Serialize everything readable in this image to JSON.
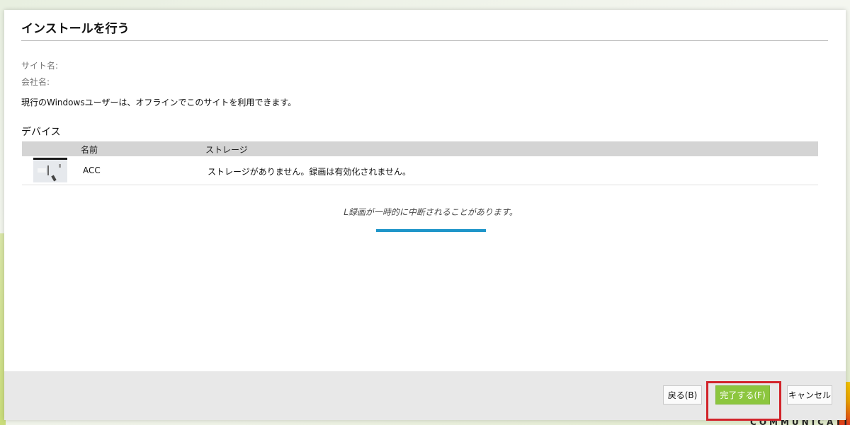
{
  "dialog": {
    "title": "インストールを行う",
    "site_label": "サイト名:",
    "company_label": "会社名:",
    "info": "現行のWindowsユーザーは、オフラインでこのサイトを利用できます。"
  },
  "devices": {
    "section_title": "デバイス",
    "columns": [
      "名前",
      "ストレージ"
    ],
    "rows": [
      {
        "name": "ACC",
        "storage": "ストレージがありません。録画は有効化されません。"
      }
    ]
  },
  "status": {
    "message": "L録画が一時的に中断されることがあります。",
    "progress_color": "#1e95c9"
  },
  "footer": {
    "back_label": "戻る(B)",
    "finish_label": "完了する(F)",
    "cancel_label": "キャンセル"
  },
  "background": {
    "brand_text": "COMMUNICATI"
  },
  "colors": {
    "accent_green": "#8cc63e",
    "highlight_red": "#d2232a"
  }
}
